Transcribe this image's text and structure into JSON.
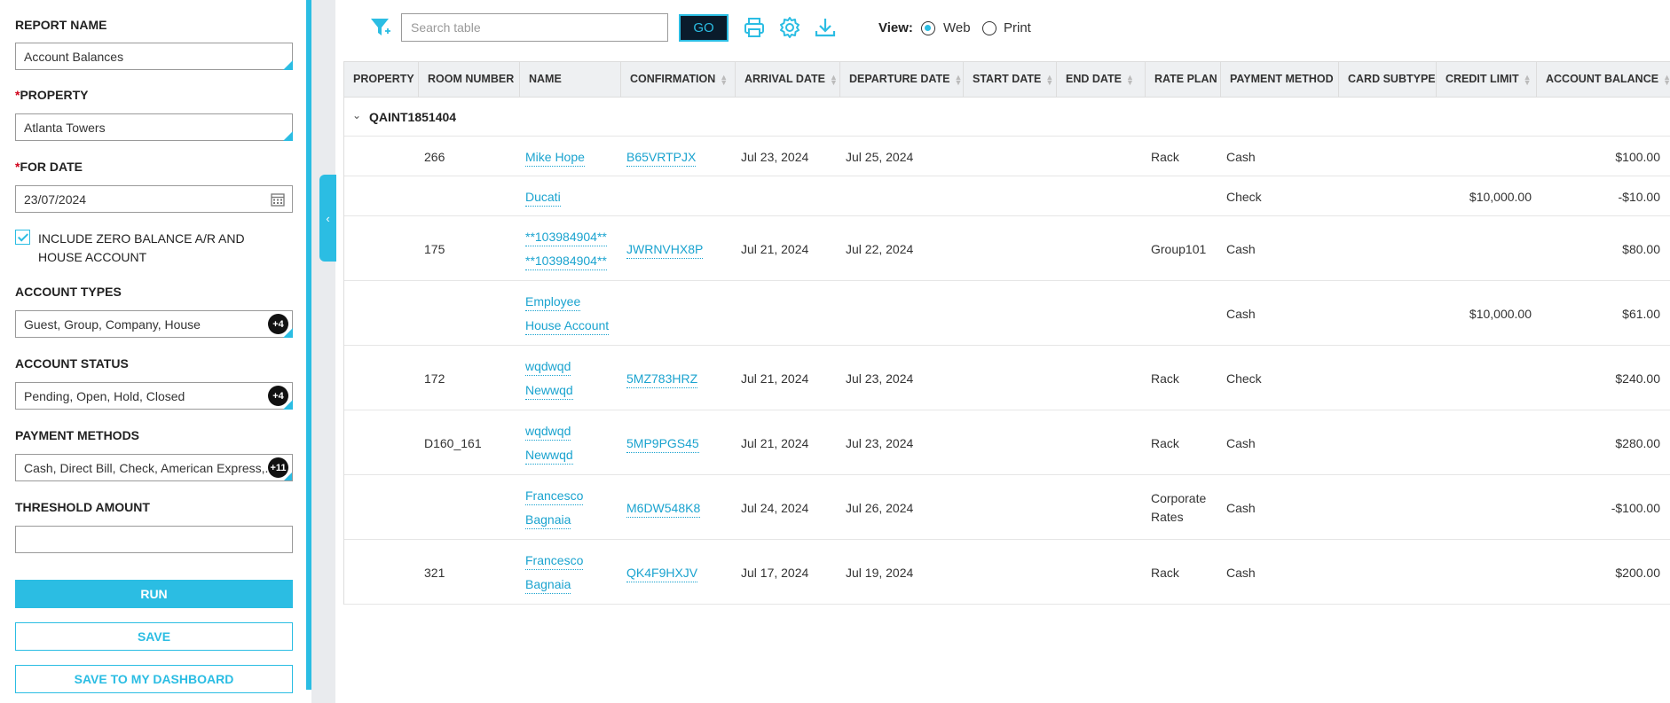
{
  "left_panel": {
    "report_name": {
      "label": "REPORT NAME",
      "value": "Account Balances"
    },
    "property": {
      "required_mark": "*",
      "label": "PROPERTY",
      "value": "Atlanta Towers"
    },
    "for_date": {
      "required_mark": "*",
      "label": "FOR DATE",
      "value": "23/07/2024"
    },
    "include_zero": {
      "label": "INCLUDE ZERO BALANCE A/R AND HOUSE ACCOUNT",
      "checked": true
    },
    "account_types": {
      "label": "ACCOUNT TYPES",
      "value": "Guest, Group, Company, House",
      "badge": "+4"
    },
    "account_status": {
      "label": "ACCOUNT STATUS",
      "value": "Pending, Open, Hold, Closed",
      "badge": "+4"
    },
    "payment_methods": {
      "label": "PAYMENT METHODS",
      "value": "Cash, Direct Bill, Check, American Express,...",
      "badge": "+11"
    },
    "threshold": {
      "label": "THRESHOLD AMOUNT",
      "value": ""
    },
    "buttons": {
      "run": "RUN",
      "save": "SAVE",
      "save_dashboard": "SAVE TO MY DASHBOARD"
    },
    "collapse_glyph": "‹"
  },
  "toolbar": {
    "search_placeholder": "Search table",
    "go": "GO",
    "view_label": "View:",
    "view_options": [
      {
        "label": "Web",
        "selected": true
      },
      {
        "label": "Print",
        "selected": false
      }
    ],
    "icons": [
      "filter-icon",
      "print-icon",
      "gear-icon",
      "download-icon"
    ]
  },
  "table": {
    "columns": [
      "PROPERTY",
      "ROOM NUMBER",
      "NAME",
      "CONFIRMATION",
      "ARRIVAL DATE",
      "DEPARTURE DATE",
      "START DATE",
      "END DATE",
      "RATE PLAN",
      "PAYMENT METHOD",
      "CARD SUBTYPE",
      "CREDIT LIMIT",
      "ACCOUNT BALANCE"
    ],
    "group": "QAINT1851404",
    "rows": [
      {
        "room": "266",
        "name": [
          "Mike Hope"
        ],
        "confirmation": "B65VRTPJX",
        "arrival": "Jul 23, 2024",
        "departure": "Jul 25, 2024",
        "rate_plan": [
          "Rack"
        ],
        "payment": "Cash",
        "credit_limit": "",
        "balance": "$100.00"
      },
      {
        "room": "",
        "name": [
          "Ducati"
        ],
        "confirmation": "",
        "arrival": "",
        "departure": "",
        "rate_plan": [
          ""
        ],
        "payment": "Check",
        "credit_limit": "$10,000.00",
        "balance": "-$10.00"
      },
      {
        "room": "175",
        "name": [
          "**103984904**",
          "**103984904**"
        ],
        "confirmation": "JWRNVHX8P",
        "arrival": "Jul 21, 2024",
        "departure": "Jul 22, 2024",
        "rate_plan": [
          "Group101"
        ],
        "payment": "Cash",
        "credit_limit": "",
        "balance": "$80.00"
      },
      {
        "room": "",
        "name": [
          "Employee",
          "House Account"
        ],
        "confirmation": "",
        "arrival": "",
        "departure": "",
        "rate_plan": [
          ""
        ],
        "payment": "Cash",
        "credit_limit": "$10,000.00",
        "balance": "$61.00"
      },
      {
        "room": "172",
        "name": [
          "wqdwqd",
          "Newwqd"
        ],
        "confirmation": "5MZ783HRZ",
        "arrival": "Jul 21, 2024",
        "departure": "Jul 23, 2024",
        "rate_plan": [
          "Rack"
        ],
        "payment": "Check",
        "credit_limit": "",
        "balance": "$240.00"
      },
      {
        "room": "D160_161",
        "name": [
          "wqdwqd",
          "Newwqd"
        ],
        "confirmation": "5MP9PGS45",
        "arrival": "Jul 21, 2024",
        "departure": "Jul 23, 2024",
        "rate_plan": [
          "Rack"
        ],
        "payment": "Cash",
        "credit_limit": "",
        "balance": "$280.00"
      },
      {
        "room": "",
        "name": [
          "Francesco",
          "Bagnaia"
        ],
        "confirmation": "M6DW548K8",
        "arrival": "Jul 24, 2024",
        "departure": "Jul 26, 2024",
        "rate_plan": [
          "Corporate",
          "Rates"
        ],
        "payment": "Cash",
        "credit_limit": "",
        "balance": "-$100.00"
      },
      {
        "room": "321",
        "name": [
          "Francesco",
          "Bagnaia"
        ],
        "confirmation": "QK4F9HXJV",
        "arrival": "Jul 17, 2024",
        "departure": "Jul 19, 2024",
        "rate_plan": [
          "Rack"
        ],
        "payment": "Cash",
        "credit_limit": "",
        "balance": "$200.00"
      }
    ]
  },
  "colors": {
    "accent": "#2bbde3",
    "link": "#1aa3cf",
    "go_bg": "#0a1b2b"
  }
}
